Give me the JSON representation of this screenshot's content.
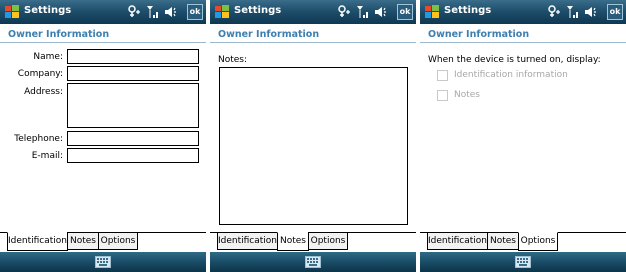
{
  "screens": [
    {
      "title": "Settings",
      "ok_label": "ok",
      "section": "Owner Information",
      "fields": [
        {
          "label": "Name:"
        },
        {
          "label": "Company:"
        },
        {
          "label": "Address:"
        },
        {
          "label": "Telephone:"
        },
        {
          "label": "E-mail:"
        }
      ],
      "tabs": [
        "Identification",
        "Notes",
        "Options"
      ],
      "active_tab": "Identification"
    },
    {
      "title": "Settings",
      "ok_label": "ok",
      "section": "Owner Information",
      "notes_label": "Notes:",
      "tabs": [
        "Identification",
        "Notes",
        "Options"
      ],
      "active_tab": "Notes"
    },
    {
      "title": "Settings",
      "ok_label": "ok",
      "section": "Owner Information",
      "options_text": "When the device is turned on, display:",
      "checkboxes": [
        {
          "label": "Identification information",
          "checked": false,
          "enabled": false
        },
        {
          "label": "Notes",
          "checked": false,
          "enabled": false
        }
      ],
      "tabs": [
        "Identification",
        "Notes",
        "Options"
      ],
      "active_tab": "Options"
    }
  ],
  "icons": {
    "start": "windows-flag-icon",
    "connectivity": "connectivity-icon",
    "signal": "signal-strength-icon",
    "volume": "speaker-volume-icon",
    "keyboard": "keyboard-icon"
  },
  "colors": {
    "titlebar": "#1e4f6c",
    "section_header": "#3d7fb0",
    "softbar": "#1a4d67"
  }
}
